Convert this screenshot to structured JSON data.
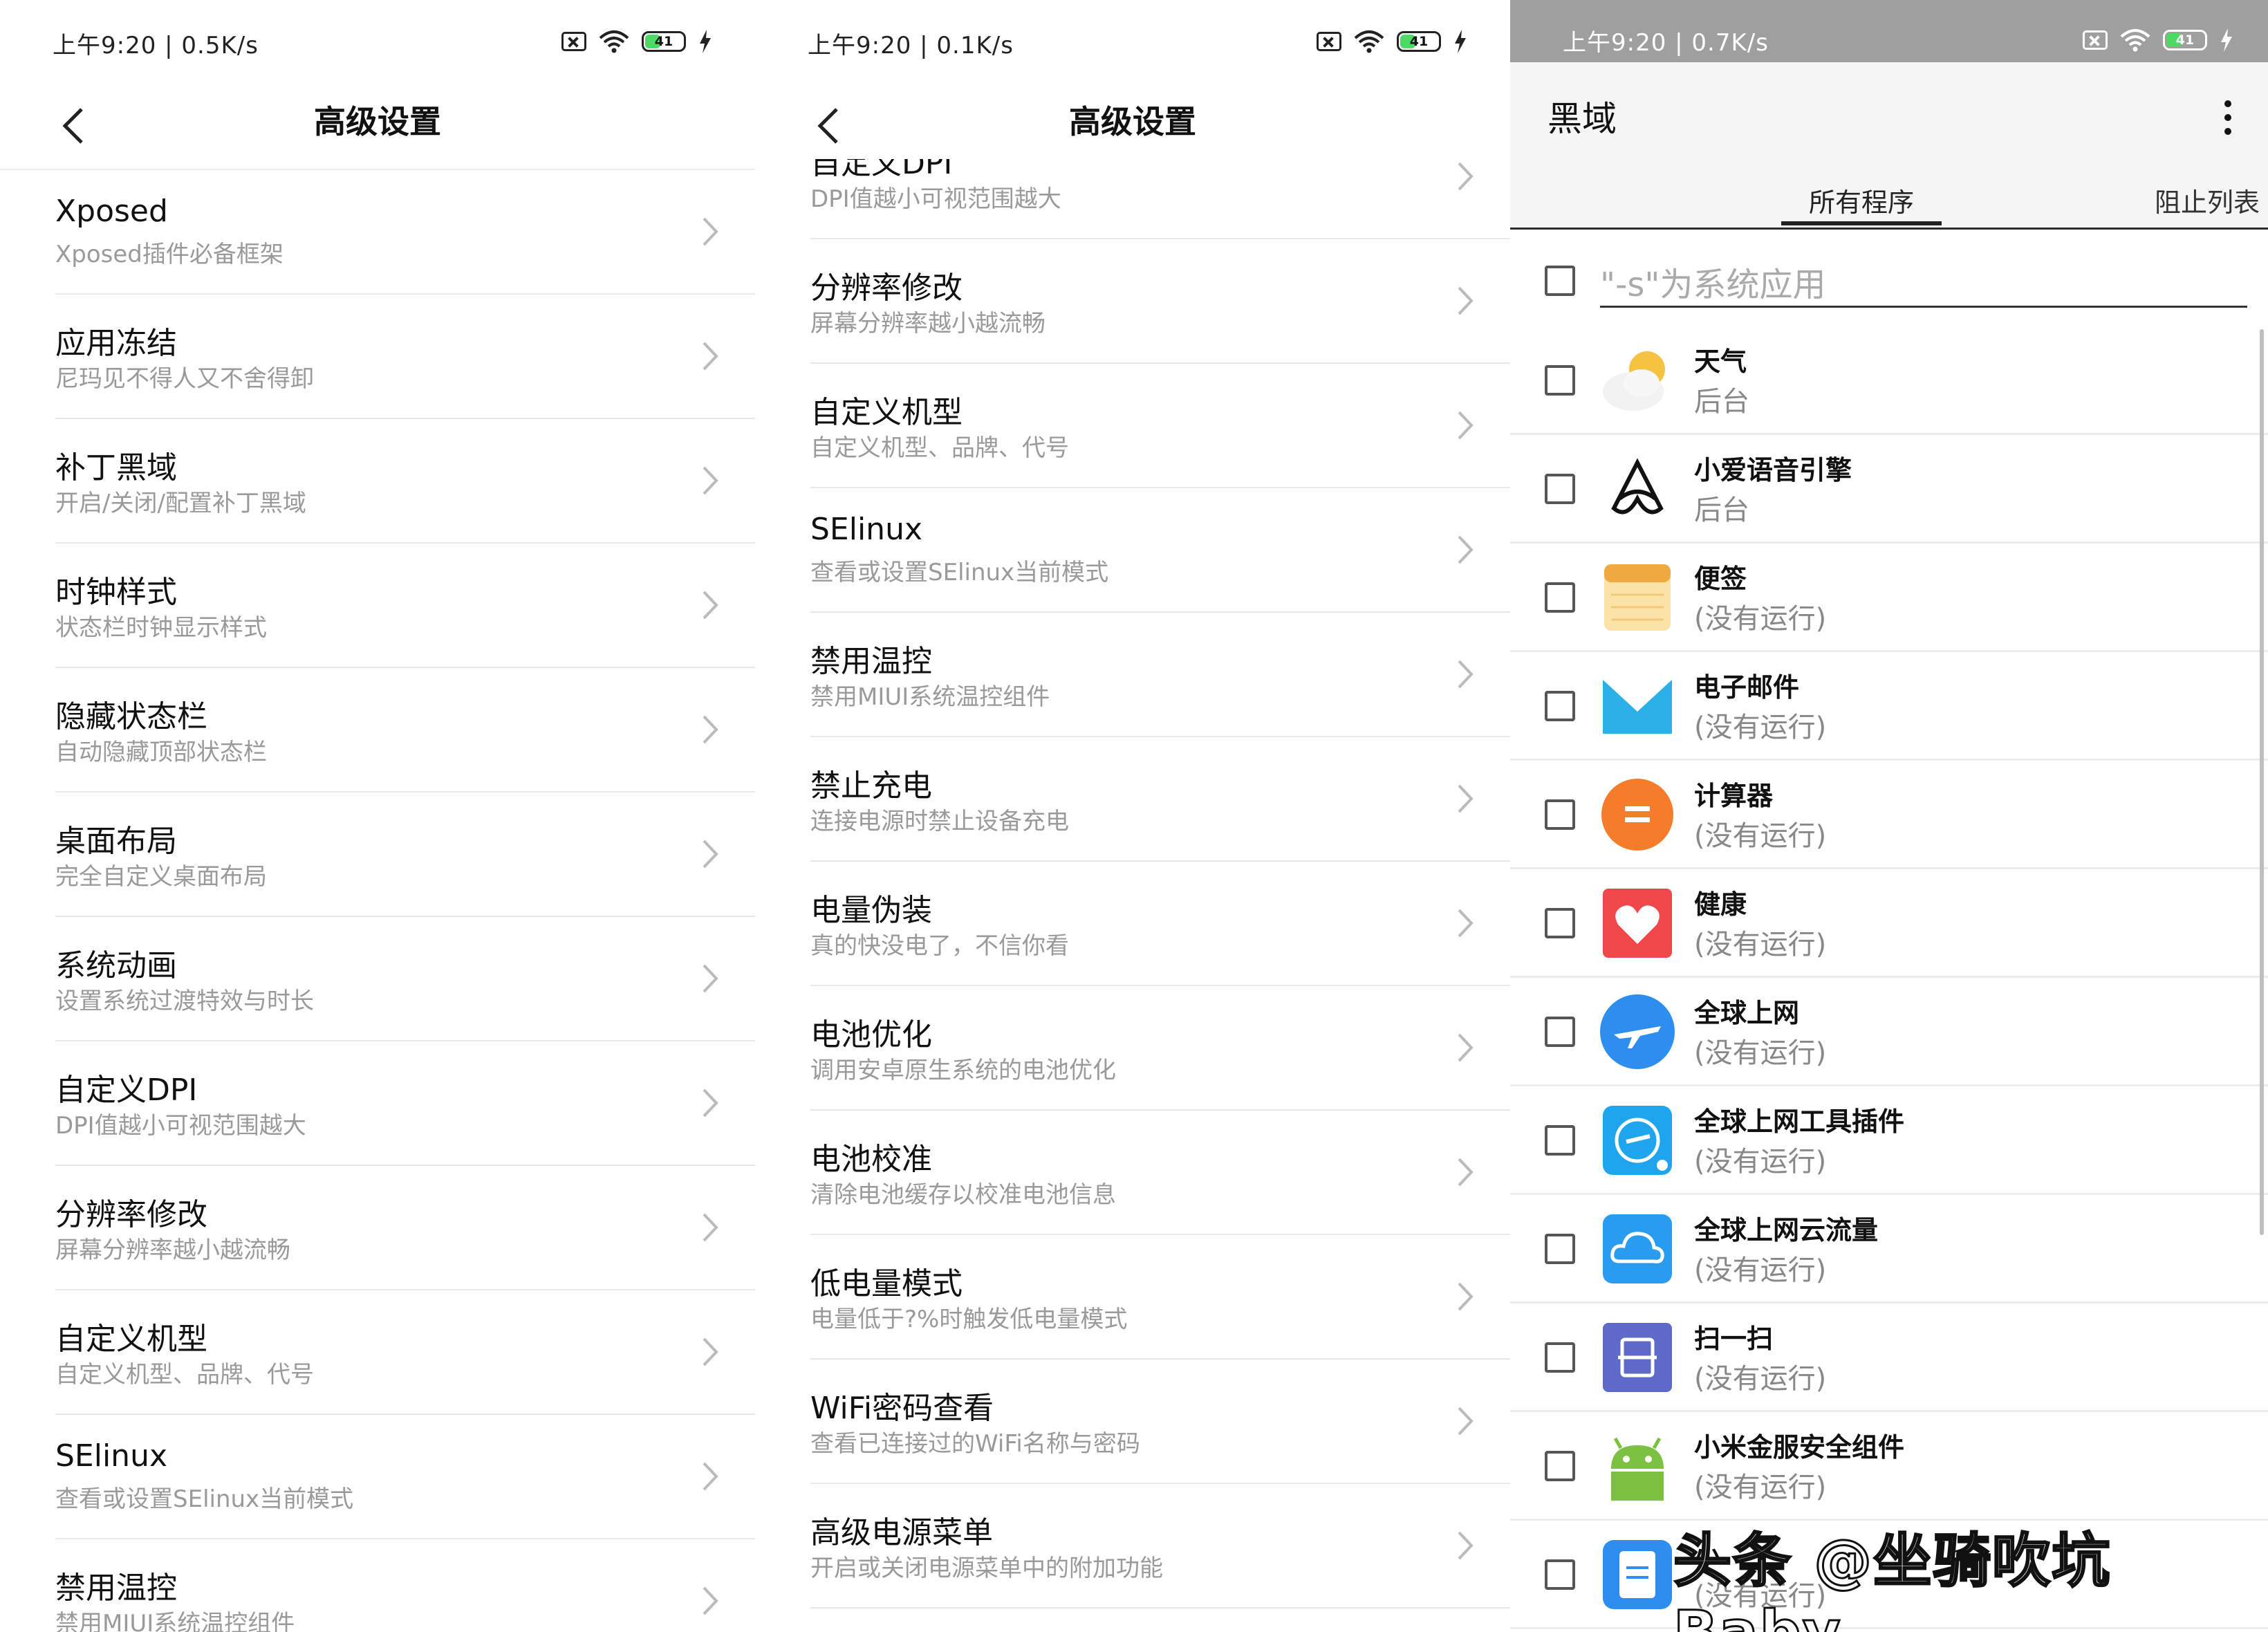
{
  "panel1": {
    "status": {
      "time": "上午9:20 | 0.5K/s",
      "battery": "41"
    },
    "title": "高级设置",
    "items": [
      {
        "name": "Xposed",
        "desc": "Xposed插件必备框架"
      },
      {
        "name": "应用冻结",
        "desc": "尼玛见不得人又不舍得卸"
      },
      {
        "name": "补丁黑域",
        "desc": "开启/关闭/配置补丁黑域"
      },
      {
        "name": "时钟样式",
        "desc": "状态栏时钟显示样式"
      },
      {
        "name": "隐藏状态栏",
        "desc": "自动隐藏顶部状态栏"
      },
      {
        "name": "桌面布局",
        "desc": "完全自定义桌面布局"
      },
      {
        "name": "系统动画",
        "desc": "设置系统过渡特效与时长"
      },
      {
        "name": "自定义DPI",
        "desc": "DPI值越小可视范围越大"
      },
      {
        "name": "分辨率修改",
        "desc": "屏幕分辨率越小越流畅"
      },
      {
        "name": "自定义机型",
        "desc": "自定义机型、品牌、代号"
      },
      {
        "name": "SElinux",
        "desc": "查看或设置SElinux当前模式"
      },
      {
        "name": "禁用温控",
        "desc": "禁用MIUI系统温控组件"
      }
    ]
  },
  "panel2": {
    "status": {
      "time": "上午9:20 | 0.1K/s",
      "battery": "41"
    },
    "title": "高级设置",
    "items": [
      {
        "name": "自定义DPI",
        "desc": "DPI值越小可视范围越大"
      },
      {
        "name": "分辨率修改",
        "desc": "屏幕分辨率越小越流畅"
      },
      {
        "name": "自定义机型",
        "desc": "自定义机型、品牌、代号"
      },
      {
        "name": "SElinux",
        "desc": "查看或设置SElinux当前模式"
      },
      {
        "name": "禁用温控",
        "desc": "禁用MIUI系统温控组件"
      },
      {
        "name": "禁止充电",
        "desc": "连接电源时禁止设备充电"
      },
      {
        "name": "电量伪装",
        "desc": "真的快没电了，不信你看"
      },
      {
        "name": "电池优化",
        "desc": "调用安卓原生系统的电池优化"
      },
      {
        "name": "电池校准",
        "desc": "清除电池缓存以校准电池信息"
      },
      {
        "name": "低电量模式",
        "desc": "电量低于?%时触发低电量模式"
      },
      {
        "name": "WiFi密码查看",
        "desc": "查看已连接过的WiFi名称与密码"
      },
      {
        "name": "高级电源菜单",
        "desc": "开启或关闭电源菜单中的附加功能"
      }
    ]
  },
  "panel3": {
    "status": {
      "time": "上午9:20 | 0.7K/s",
      "battery": "41"
    },
    "title": "黑域",
    "tabs": [
      "所有程序",
      "阻止列表"
    ],
    "filter_label": "\"-s\"为系统应用",
    "apps": [
      {
        "name": "天气",
        "state": "后台",
        "icon": "weather-icon",
        "color": "#f5c242"
      },
      {
        "name": "小爱语音引擎",
        "state": "后台",
        "icon": "xiaoai-icon",
        "color": "#111111"
      },
      {
        "name": "便签",
        "state": "(没有运行)",
        "icon": "notes-icon",
        "color": "#f7c35b"
      },
      {
        "name": "电子邮件",
        "state": "(没有运行)",
        "icon": "mail-icon",
        "color": "#2bb0e8"
      },
      {
        "name": "计算器",
        "state": "(没有运行)",
        "icon": "calculator-icon",
        "color": "#f57c2b"
      },
      {
        "name": "健康",
        "state": "(没有运行)",
        "icon": "health-icon",
        "color": "#f0474b"
      },
      {
        "name": "全球上网",
        "state": "(没有运行)",
        "icon": "global-net-icon",
        "color": "#2e8ef0"
      },
      {
        "name": "全球上网工具插件",
        "state": "(没有运行)",
        "icon": "global-tool-icon",
        "color": "#1fa5ee"
      },
      {
        "name": "全球上网云流量",
        "state": "(没有运行)",
        "icon": "cloud-icon",
        "color": "#2a9cf0"
      },
      {
        "name": "扫一扫",
        "state": "(没有运行)",
        "icon": "scan-icon",
        "color": "#5e6ac8"
      },
      {
        "name": "小米金服安全组件",
        "state": "(没有运行)",
        "icon": "android-icon",
        "color": "#7cc142"
      },
      {
        "name": "小",
        "state": "(没有运行)",
        "icon": "doc-icon",
        "color": "#2e8ef0"
      }
    ],
    "watermark": "头条 @坐骑吹坑Baby"
  }
}
